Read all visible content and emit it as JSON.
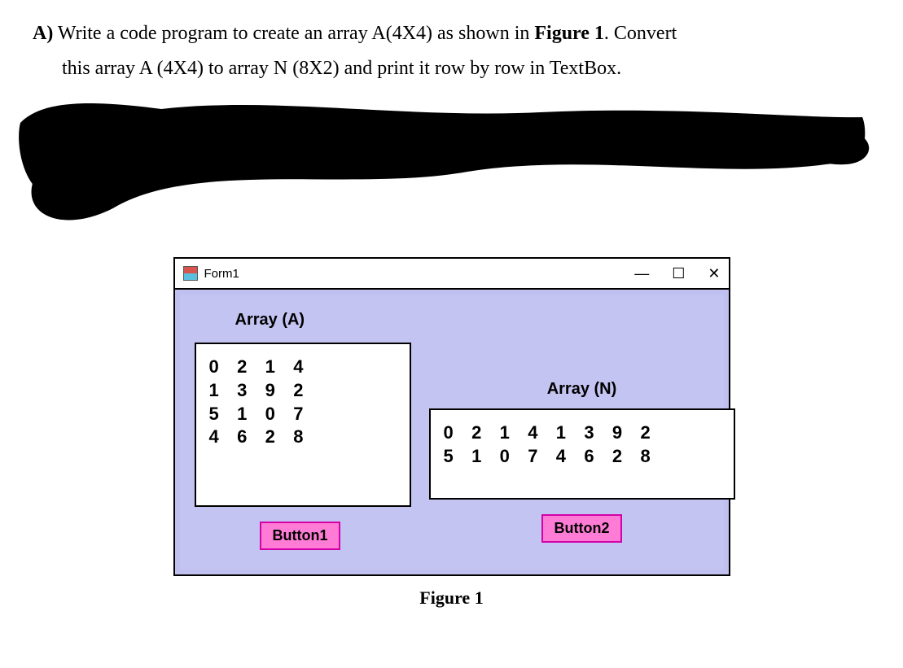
{
  "question": {
    "label": "A)",
    "line1_before": " Write a code program to create an array A(4X4) as shown in ",
    "fig_ref": "Figure 1",
    "line1_after": ". Convert",
    "line2": "this array A (4X4) to array N (8X2) and print it row by row in TextBox."
  },
  "window": {
    "title": "Form1",
    "controls": {
      "min": "—",
      "max": "☐",
      "close": "✕"
    }
  },
  "arrays": {
    "a_label": "Array (A)",
    "n_label": "Array (N)",
    "a_text": "0   2   1   4\n1   3   9   2\n5   1   0   7\n4   6   2   8",
    "n_text": "0   2   1   4   1   3   9   2\n5   1   0   7   4   6   2   8"
  },
  "buttons": {
    "b1": "Button1",
    "b2": "Button2"
  },
  "figure_caption": "Figure 1",
  "chart_data": {
    "type": "table",
    "array_A_4x4": [
      [
        0,
        2,
        1,
        4
      ],
      [
        1,
        3,
        9,
        2
      ],
      [
        5,
        1,
        0,
        7
      ],
      [
        4,
        6,
        2,
        8
      ]
    ],
    "array_N_8x2_printed_as_2x8": [
      [
        0,
        2,
        1,
        4,
        1,
        3,
        9,
        2
      ],
      [
        5,
        1,
        0,
        7,
        4,
        6,
        2,
        8
      ]
    ]
  }
}
